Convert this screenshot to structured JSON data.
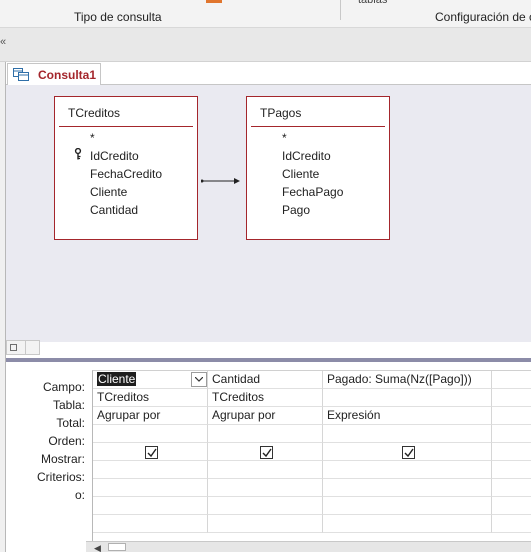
{
  "ribbon": {
    "group1": "Tipo de consulta",
    "group2": "Configuración de c",
    "cut_label": "tablas"
  },
  "strip_mark": "«",
  "tab": {
    "label": "Consulta1"
  },
  "tables": [
    {
      "title": "TCreditos",
      "fields": [
        "*",
        "IdCredito",
        "FechaCredito",
        "Cliente",
        "Cantidad"
      ],
      "primary_key": "IdCredito"
    },
    {
      "title": "TPagos",
      "fields": [
        "*",
        "IdCredito",
        "Cliente",
        "FechaPago",
        "Pago"
      ]
    }
  ],
  "grid": {
    "row_labels": [
      "Campo:",
      "Tabla:",
      "Total:",
      "Orden:",
      "Mostrar:",
      "Criterios:",
      "o:"
    ],
    "columns": [
      {
        "campo": "Cliente",
        "tabla": "TCreditos",
        "total": "Agrupar por",
        "orden": "",
        "mostrar": true,
        "criterios": "",
        "o": ""
      },
      {
        "campo": "Cantidad",
        "tabla": "TCreditos",
        "total": "Agrupar por",
        "orden": "",
        "mostrar": true,
        "criterios": "",
        "o": ""
      },
      {
        "campo": "Pagado: Suma(Nz([Pago]))",
        "tabla": "",
        "total": "Expresión",
        "orden": "",
        "mostrar": true,
        "criterios": "",
        "o": ""
      }
    ]
  },
  "colors": {
    "accent_red": "#a4262c",
    "design_bg": "#eaeaf1",
    "splitter": "#8c8ca8"
  }
}
